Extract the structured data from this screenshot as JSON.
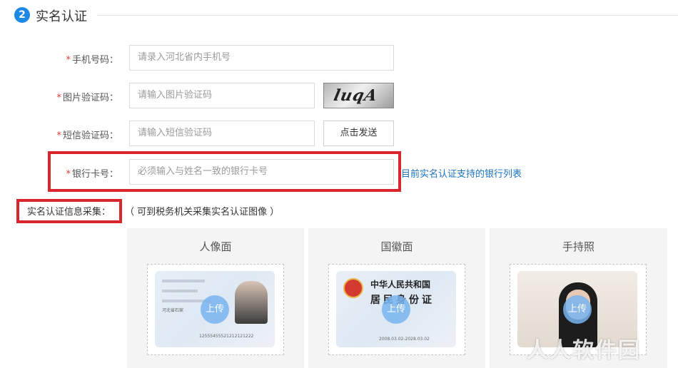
{
  "section": {
    "step_number": "2",
    "title": "实名认证"
  },
  "form": {
    "phone": {
      "label": "手机号码：",
      "placeholder": "请录入河北省内手机号"
    },
    "image_code": {
      "label": "图片验证码：",
      "placeholder": "请输入图片验证码",
      "captcha_text": "luqA"
    },
    "sms_code": {
      "label": "短信验证码：",
      "placeholder": "请输入短信验证码",
      "send_label": "点击发送"
    },
    "bank_card": {
      "label": "银行卡号：",
      "placeholder": "必须输入与姓名一致的银行卡号",
      "link": "目前实名认证支持的银行列表"
    },
    "required_mark": "*"
  },
  "collect": {
    "label": "实名认证信息采集：",
    "note": "（ 可到税务机关采集实名认证图像 ）"
  },
  "photos": [
    {
      "title": "人像面",
      "upload": "上传",
      "card_number": "12555455521212121222",
      "card_text": "河北省石家"
    },
    {
      "title": "国徽面",
      "upload": "上传",
      "card_header": "中华人民共和国",
      "card_sub": "居民身份证",
      "valid_text": "2008.03.02-2028.03.02"
    },
    {
      "title": "手持照",
      "upload": "上传"
    }
  ],
  "watermark": "人人软件园",
  "colors": {
    "accent": "#1e88e5",
    "highlight_red": "#d9252b",
    "link": "#1e73be",
    "required": "#e53935"
  }
}
